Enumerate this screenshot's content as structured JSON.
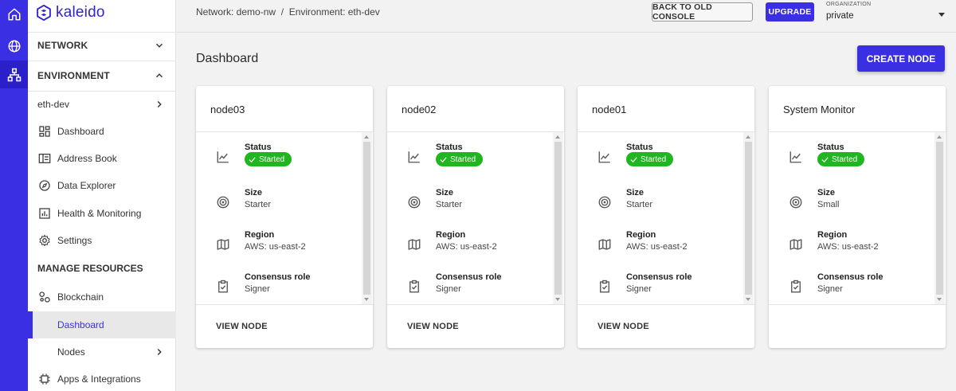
{
  "app": {
    "brand": "kaleido",
    "accent": "#3b2fe3",
    "status_color": "#21b521"
  },
  "sidebar": {
    "network_label": "NETWORK",
    "environment_label": "ENVIRONMENT",
    "env_name": "eth-dev",
    "items": [
      {
        "label": "Dashboard",
        "icon": "dashboard-icon"
      },
      {
        "label": "Address Book",
        "icon": "address-book-icon"
      },
      {
        "label": "Data Explorer",
        "icon": "compass-icon"
      },
      {
        "label": "Health & Monitoring",
        "icon": "chart-icon"
      },
      {
        "label": "Settings",
        "icon": "gear-icon"
      }
    ],
    "manage_label": "MANAGE RESOURCES",
    "blockchain_label": "Blockchain",
    "sub_dashboard_label": "Dashboard",
    "nodes_label": "Nodes",
    "apps_label": "Apps & Integrations"
  },
  "topbar": {
    "breadcrumb": "Network: demo-nw  /  Environment: eth-dev",
    "old_console_label": "BACK TO OLD CONSOLE",
    "upgrade_label": "UPGRADE",
    "org_label": "ORGANIZATION",
    "org_value": "private"
  },
  "main": {
    "title": "Dashboard",
    "create_label": "CREATE NODE",
    "labels": {
      "status": "Status",
      "size": "Size",
      "region": "Region",
      "consensus": "Consensus role"
    },
    "cards": [
      {
        "title": "node03",
        "status": "Started",
        "size": "Starter",
        "region": "AWS: us-east-2",
        "consensus": "Signer",
        "action": "VIEW NODE"
      },
      {
        "title": "node02",
        "status": "Started",
        "size": "Starter",
        "region": "AWS: us-east-2",
        "consensus": "Signer",
        "action": "VIEW NODE"
      },
      {
        "title": "node01",
        "status": "Started",
        "size": "Starter",
        "region": "AWS: us-east-2",
        "consensus": "Signer",
        "action": "VIEW NODE"
      },
      {
        "title": "System Monitor",
        "status": "Started",
        "size": "Small",
        "region": "AWS: us-east-2",
        "consensus": "Signer",
        "action": ""
      }
    ]
  }
}
